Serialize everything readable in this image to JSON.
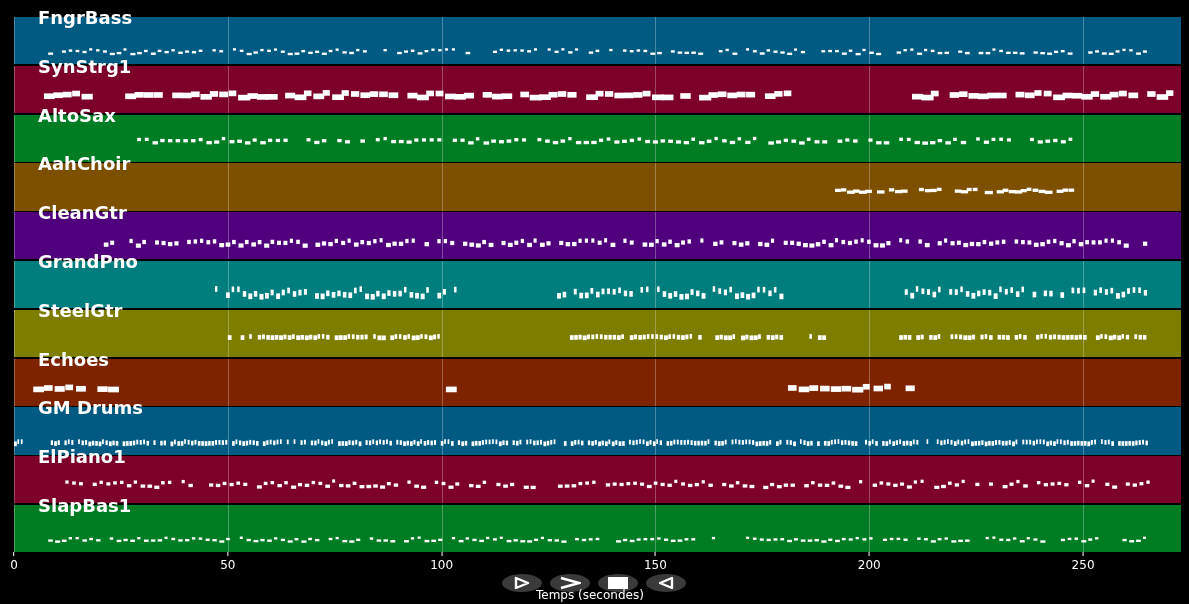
{
  "tracks": [
    {
      "name": "FngrBass",
      "color": "#005a82"
    },
    {
      "name": "SynStrg1",
      "color": "#7d0028"
    },
    {
      "name": "AltoSax",
      "color": "#007d23"
    },
    {
      "name": "AahChoir",
      "color": "#7d5000"
    },
    {
      "name": "CleanGtr",
      "color": "#50007d"
    },
    {
      "name": "GrandPno",
      "color": "#007d7d"
    },
    {
      "name": "SteelGtr",
      "color": "#7d7d00"
    },
    {
      "name": "Echoes",
      "color": "#7d2300"
    },
    {
      "name": "GM Drums",
      "color": "#005a82"
    },
    {
      "name": "ElPiano1",
      "color": "#7d0028"
    },
    {
      "name": "SlapBas1",
      "color": "#007d23"
    }
  ],
  "x_axis": {
    "label": "Temps (secondes)",
    "ticks": [
      "0",
      "50",
      "100",
      "150",
      "200",
      "250"
    ]
  }
}
